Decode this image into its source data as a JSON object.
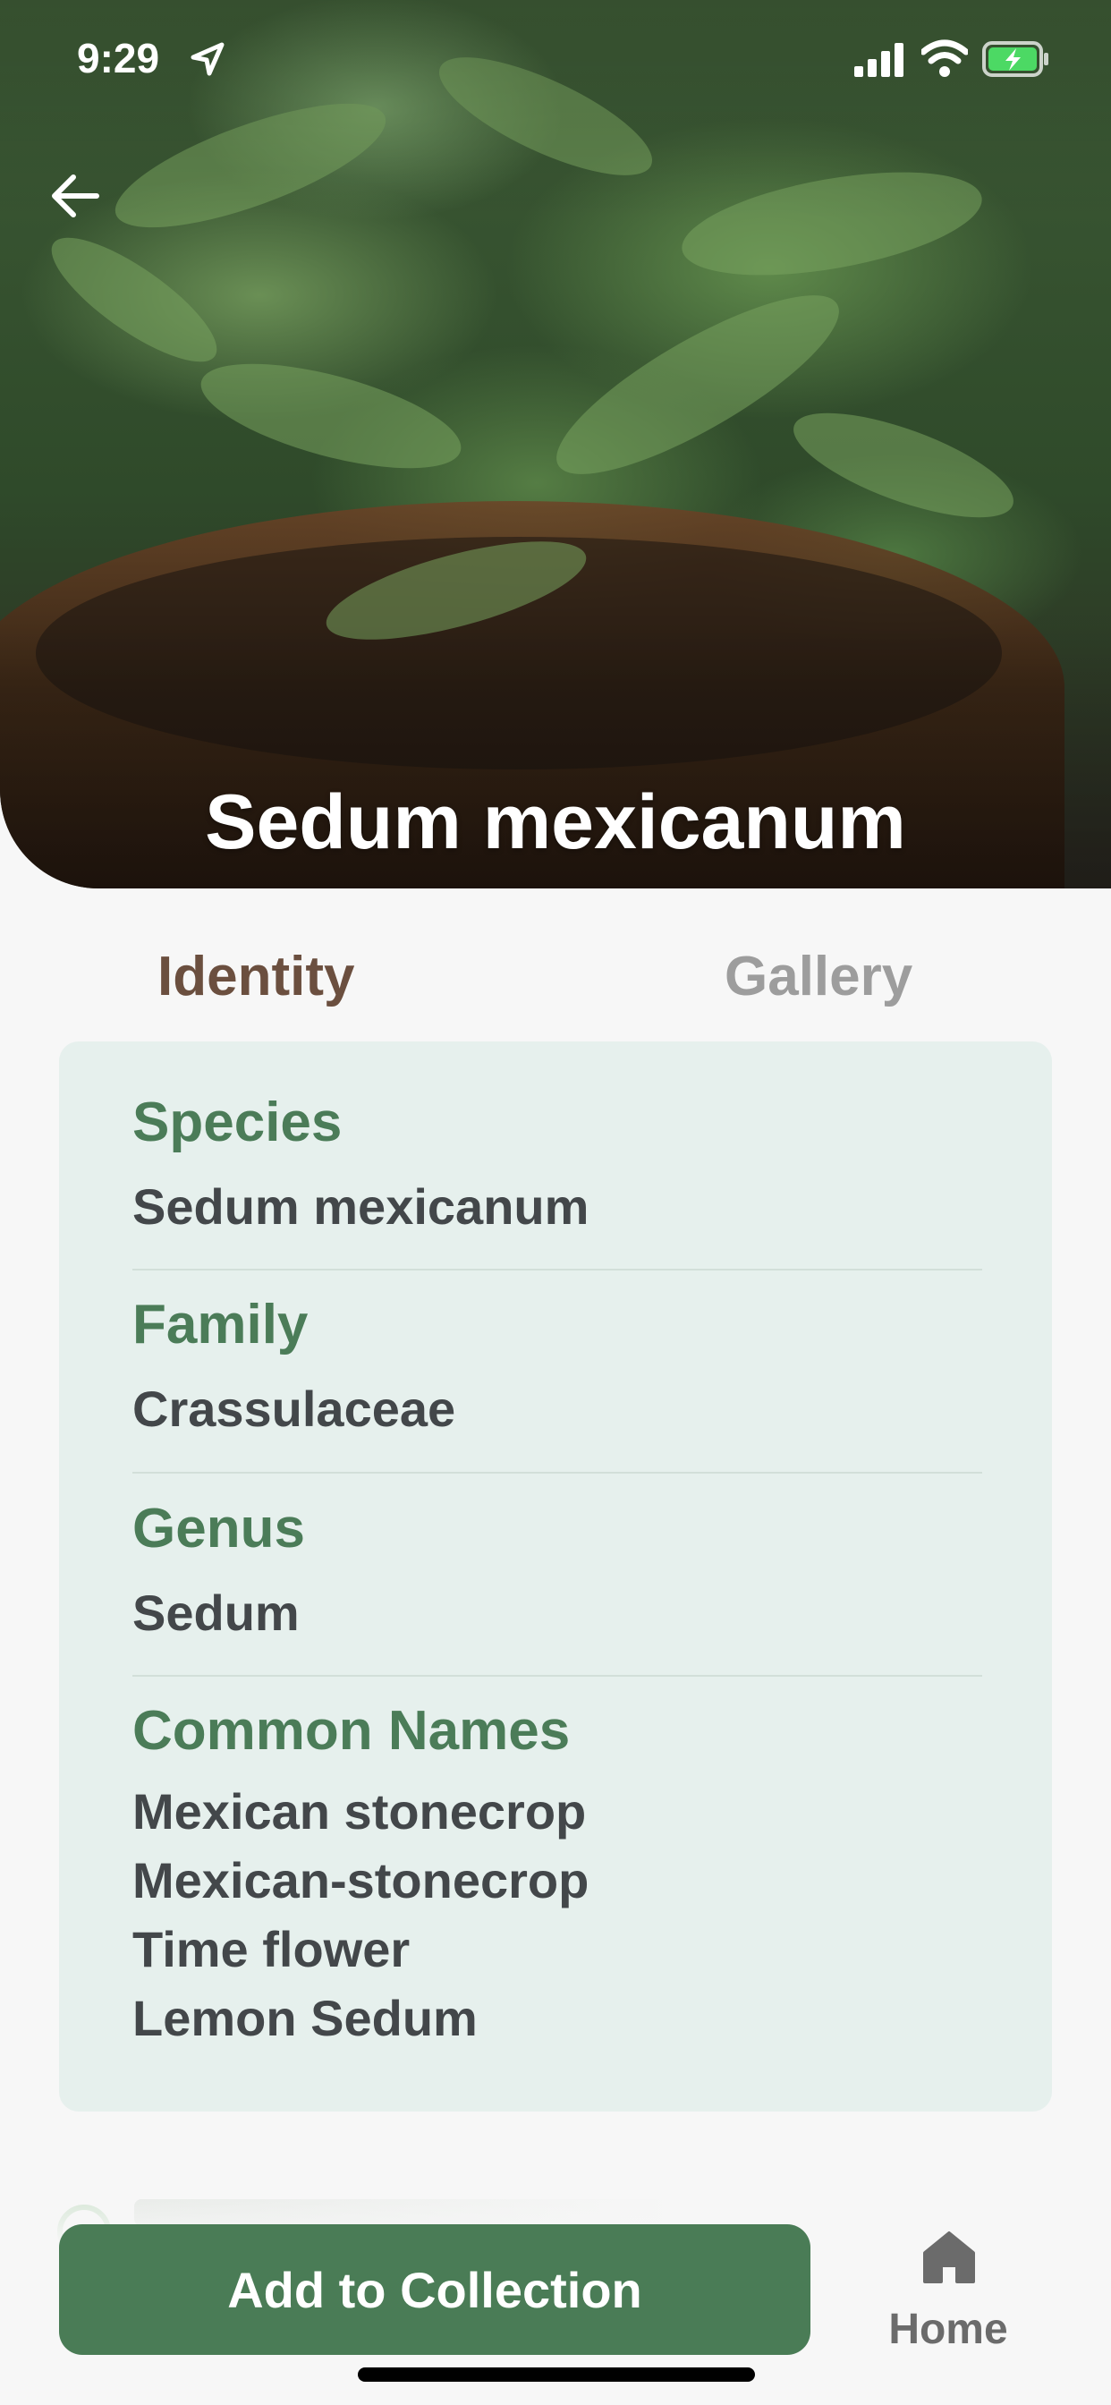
{
  "status_bar": {
    "time": "9:29"
  },
  "header": {
    "title": "Sedum mexicanum"
  },
  "tabs": [
    {
      "label": "Identity",
      "active": true
    },
    {
      "label": "Gallery",
      "active": false
    }
  ],
  "identity": {
    "species": {
      "label": "Species",
      "value": "Sedum mexicanum"
    },
    "family": {
      "label": "Family",
      "value": "Crassulaceae"
    },
    "genus": {
      "label": "Genus",
      "value": "Sedum"
    },
    "common_names": {
      "label": "Common Names",
      "values": [
        "Mexican stonecrop",
        "Mexican-stonecrop",
        "Time flower",
        "Lemon Sedum"
      ]
    }
  },
  "actions": {
    "add_to_collection": "Add to Collection"
  },
  "bottom_nav": {
    "home_label": "Home"
  },
  "colors": {
    "accent_green": "#4a7c56",
    "label_green": "#4b7c58",
    "card_background": "#e6f0ed",
    "active_tab": "#6b4f3f",
    "inactive_tab": "#9d9d9d"
  }
}
